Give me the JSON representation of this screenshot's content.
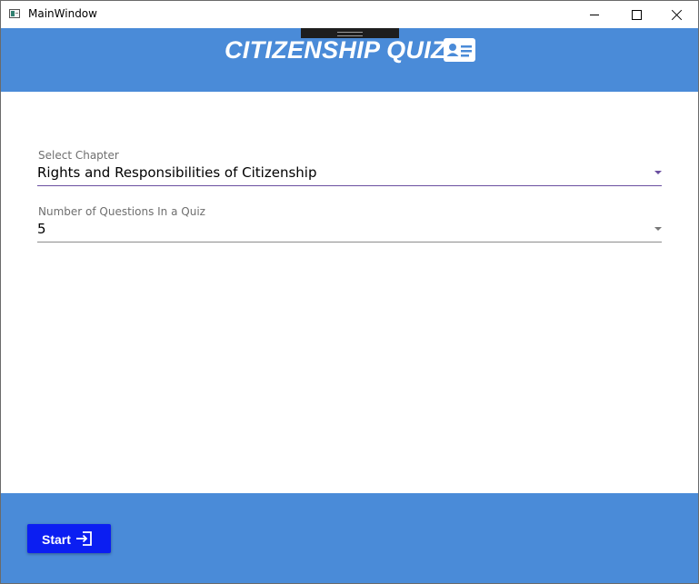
{
  "window": {
    "title": "MainWindow",
    "controls": {
      "minimize": "minimize-icon",
      "maximize": "maximize-icon",
      "close": "close-icon"
    }
  },
  "header": {
    "title": "CITIZENSHIP QUIZ",
    "icon": "id-card-icon",
    "background_color": "#4a8bd8"
  },
  "form": {
    "chapter": {
      "label": "Select Chapter",
      "value": "Rights and Responsibilities of Citizenship"
    },
    "question_count": {
      "label": "Number of Questions In a Quiz",
      "value": "5"
    }
  },
  "footer": {
    "start_button": {
      "label": "Start",
      "icon": "login-icon",
      "color": "#0b1ef2"
    }
  },
  "colors": {
    "accent": "#6a4fa0",
    "header_footer": "#4a8bd8",
    "button": "#0b1ef2"
  }
}
